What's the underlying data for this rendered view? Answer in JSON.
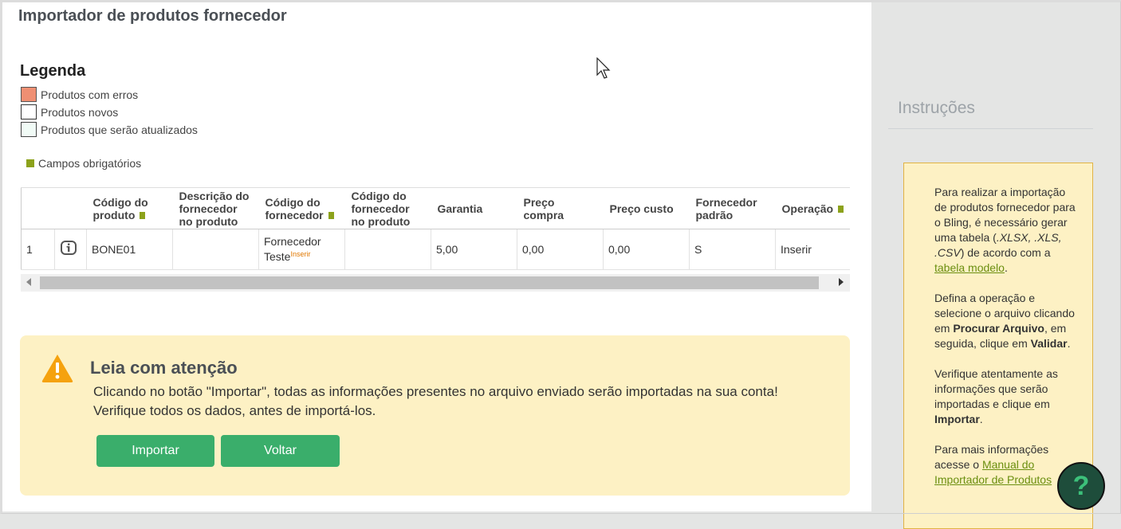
{
  "page": {
    "title": "Importador de produtos fornecedor"
  },
  "legend": {
    "title": "Legenda",
    "items": [
      {
        "label": "Produtos com erros",
        "color": "#ef8f73"
      },
      {
        "label": "Produtos novos",
        "color": "#ffffff"
      },
      {
        "label": "Produtos que serão atualizados",
        "color": "#f1fbf6"
      }
    ],
    "required_note": "Campos obrigatórios",
    "required_color": "#8ca21b"
  },
  "table": {
    "headers": {
      "codigo_produto": "Código do produto",
      "descricao": "Descrição do fornecedor no produto",
      "codigo_fornecedor": "Código do fornecedor",
      "codigo_fornecedor_produto": "Código do fornecedor no produto",
      "garantia": "Garantia",
      "preco_compra": "Preço compra",
      "preco_custo": "Preço custo",
      "fornecedor_padrao": "Fornecedor padrão",
      "operacao": "Operação"
    },
    "rows": [
      {
        "index": "1",
        "icon": "info-icon",
        "codigo_produto": "BONE01",
        "descricao": "",
        "codigo_fornecedor": "Fornecedor Teste",
        "codigo_fornecedor_tag": "Inserir",
        "codigo_fornecedor_produto": "",
        "garantia": "5,00",
        "preco_compra": "0,00",
        "preco_custo": "0,00",
        "fornecedor_padrao": "S",
        "operacao": "Inserir"
      }
    ]
  },
  "alert": {
    "icon": "warning-icon",
    "title": "Leia com atenção",
    "line1": "Clicando no botão \"Importar\", todas as informações presentes no arquivo enviado serão importadas na sua conta!",
    "line2": "Verifique todos os dados, antes de importá-los.",
    "import_label": "Importar",
    "back_label": "Voltar"
  },
  "sidebar": {
    "title": "Instruções",
    "p1_a": "Para realizar a importação de produtos fornecedor para o Bling, é necessário gerar uma tabela (",
    "p1_formats": ".XLSX, .XLS, .CSV",
    "p1_b": ") de acordo com a ",
    "p1_link": "tabela modelo",
    "p1_c": ".",
    "p2_a": "Defina a operação e selecione o arquivo clicando em ",
    "p2_b1": "Procurar Arquivo",
    "p2_c": ", em seguida, clique em ",
    "p2_b2": "Validar",
    "p2_d": ".",
    "p3_a": "Verifique atentamente as informações que serão importadas e clique em ",
    "p3_b": "Importar",
    "p3_c": ".",
    "p4_a": "Para mais informações acesse o ",
    "p4_link": "Manual do Importador de Produtos",
    "help_label": "?"
  },
  "colors": {
    "accent": "#3aae6b",
    "alert_bg": "#fdf1c4",
    "link": "#6b8f10"
  }
}
